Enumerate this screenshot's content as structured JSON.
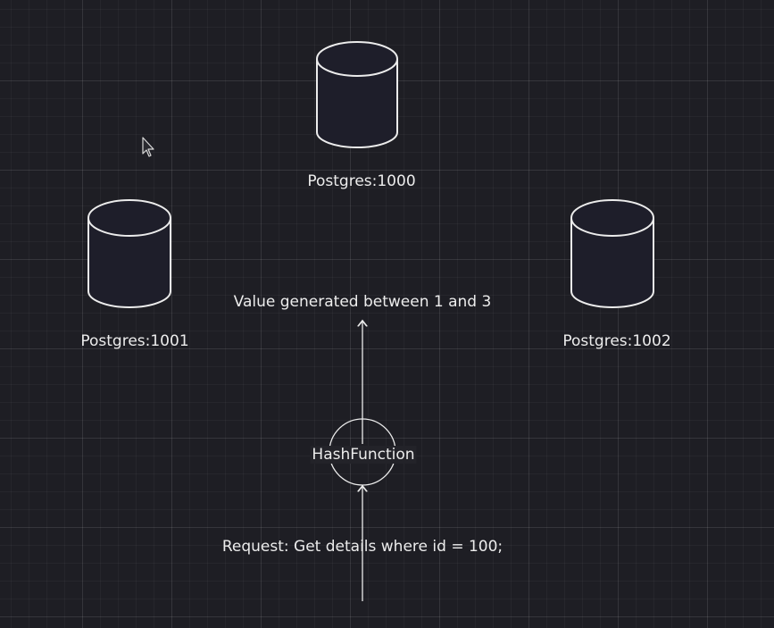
{
  "diagram": {
    "stroke_color": "#ececec",
    "background_color": "#1e1e24",
    "nodes": [
      {
        "id": "db-1000",
        "kind": "database-cylinder",
        "label": "Postgres:1000"
      },
      {
        "id": "db-1001",
        "kind": "database-cylinder",
        "label": "Postgres:1001"
      },
      {
        "id": "db-1002",
        "kind": "database-cylinder",
        "label": "Postgres:1002"
      },
      {
        "id": "hash",
        "kind": "circle",
        "label": "HashFunction"
      }
    ],
    "texts": {
      "value_range": "Value generated between 1 and 3",
      "request": "Request: Get details where id = 100;"
    },
    "edges": [
      {
        "from": "request",
        "to": "hash",
        "style": "arrow"
      },
      {
        "from": "hash",
        "to": "value_range",
        "style": "arrow"
      }
    ]
  },
  "cursor": {
    "icon": "pointer-cursor-icon"
  }
}
